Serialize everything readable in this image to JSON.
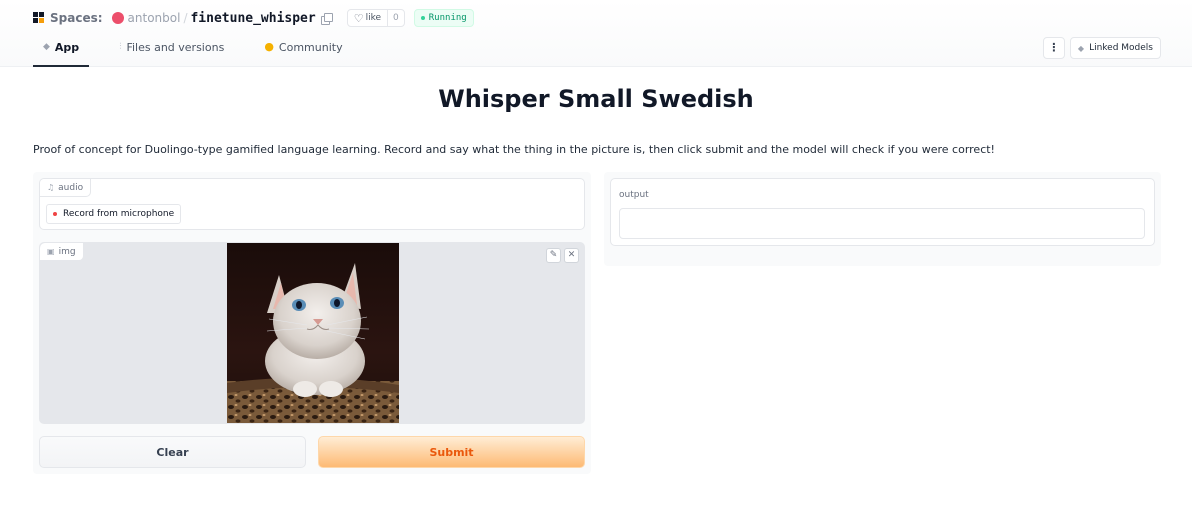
{
  "header": {
    "spaces_label": "Spaces:",
    "owner": "antonbol",
    "separator": "/",
    "repo": "finetune_whisper",
    "like_label": "like",
    "like_count": "0",
    "status": "Running",
    "tabs": [
      {
        "label": "App",
        "icon": "cube-icon",
        "active": true
      },
      {
        "label": "Files and versions",
        "icon": "files-icon",
        "active": false
      },
      {
        "label": "Community",
        "icon": "community-icon",
        "active": false
      }
    ],
    "more_label": "⋮",
    "linked_models": "Linked Models"
  },
  "app": {
    "title": "Whisper Small Swedish",
    "description": "Proof of concept for Duolingo-type gamified language learning. Record and say what the thing in the picture is, then click submit and the model will check if you were correct!",
    "audio": {
      "label": "audio",
      "record_button": "Record from microphone"
    },
    "image": {
      "label": "img",
      "content": "kitten-photo"
    },
    "buttons": {
      "clear": "Clear",
      "submit": "Submit"
    },
    "output": {
      "label": "output",
      "value": ""
    }
  },
  "colors": {
    "accent": "#ea580c",
    "running": "#059669",
    "record_dot": "#ef4444"
  }
}
